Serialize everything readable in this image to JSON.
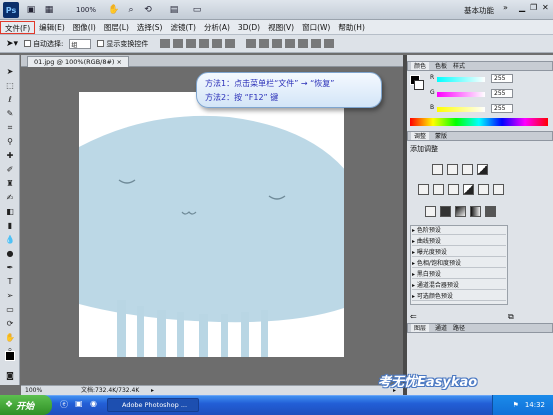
{
  "app": {
    "zoom": "100%",
    "workspace": "基本功能"
  },
  "menu": [
    {
      "label": "文件(F)"
    },
    {
      "label": "编辑(E)"
    },
    {
      "label": "图像(I)"
    },
    {
      "label": "图层(L)"
    },
    {
      "label": "选择(S)"
    },
    {
      "label": "滤镜(T)"
    },
    {
      "label": "分析(A)"
    },
    {
      "label": "3D(D)"
    },
    {
      "label": "视图(V)"
    },
    {
      "label": "窗口(W)"
    },
    {
      "label": "帮助(H)"
    }
  ],
  "options": {
    "auto_select": "自动选择:",
    "auto_select_value": "组",
    "show_transform": "显示变换控件"
  },
  "document": {
    "tab": "01.jpg @ 100%(RGB/8#)",
    "zoom": "100%",
    "doc_size": "文档:732.4K/732.4K"
  },
  "callout": {
    "line1": "方法1：点击菜单栏“文件” → “恢复”",
    "line2": "方法2：按 “F12” 键"
  },
  "color_panel": {
    "tabs": [
      "颜色",
      "色板",
      "样式"
    ],
    "r_label": "R",
    "g_label": "G",
    "b_label": "B",
    "r": "255",
    "g": "255",
    "b": "255"
  },
  "adjust_panel": {
    "tabs": [
      "调整",
      "蒙版"
    ],
    "title": "添加调整",
    "presets": [
      "色阶预设",
      "曲线预设",
      "曝光度预设",
      "色相/饱和度预设",
      "黑白预设",
      "通道混合器预设",
      "可选颜色预设"
    ]
  },
  "layers_panel": {
    "tabs": [
      "图层",
      "通道",
      "路径"
    ]
  },
  "taskbar": {
    "start": "开始",
    "task": "Adobe Photoshop ...",
    "time": "14:32"
  },
  "watermark": "考无忧Easykao",
  "colors": {
    "accent_red": "#e0392b",
    "jelly": "#bcd8e6",
    "callout_text": "#2a2fb8"
  }
}
